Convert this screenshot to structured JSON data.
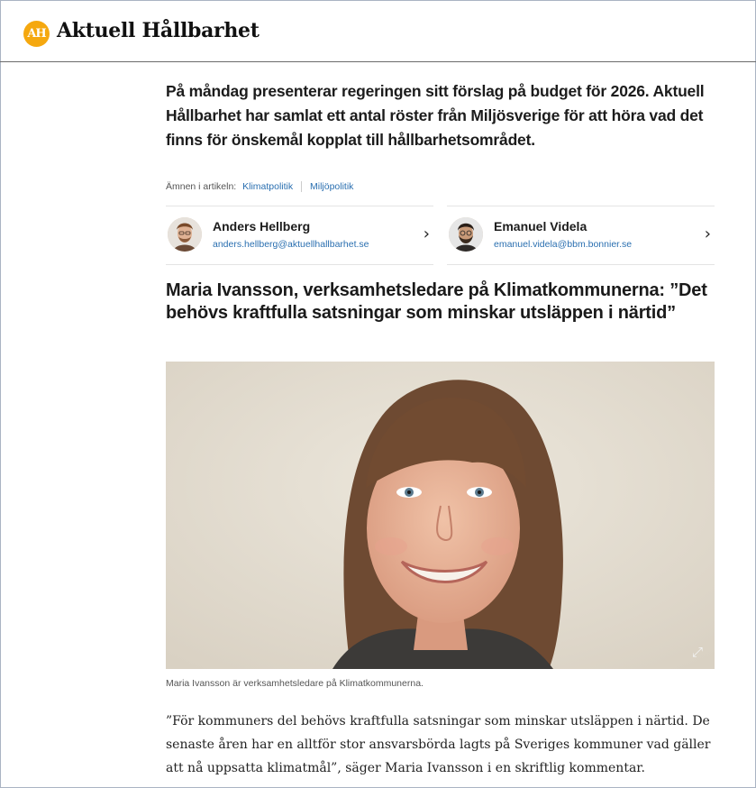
{
  "site": {
    "logo_badge": "AH",
    "name": "Aktuell Hållbarhet"
  },
  "article": {
    "ingress": "På måndag presenterar regeringen sitt förslag på budget för 2026. Aktuell Hållbarhet har samlat ett antal röster från Miljösverige för att höra vad det finns för önskemål kopplat till hållbarhetsområdet.",
    "topics_label": "Ämnen i artikeln:",
    "topics": [
      "Klimatpolitik",
      "Miljöpolitik"
    ],
    "authors": [
      {
        "name": "Anders Hellberg",
        "email": "anders.hellberg@aktuellhallbarhet.se",
        "icon": "chevron-right-icon"
      },
      {
        "name": "Emanuel Videla",
        "email": "emanuel.videla@bbm.bonnier.se",
        "icon": "chevron-right-icon"
      }
    ],
    "headline": "Maria Ivansson, verksamhetsledare på Klimatkommunerna: ”Det behövs kraftfulla satsningar som minskar utsläppen i närtid”",
    "photo_caption": "Maria Ivansson är verksamhetsledare på Klimatkommunerna.",
    "photo_expand_icon": "expand-icon",
    "body": "”För kommuners del behövs kraftfulla satsningar som minskar utsläppen i närtid. De senaste åren har en alltför stor ansvarsbörda lagts på Sveriges kommuner vad gäller att nå uppsatta klimatmål”, säger Maria Ivansson i en skriftlig kommentar."
  },
  "colors": {
    "brand": "#f5a80f",
    "link": "#2a6fb0",
    "text": "#1c1c1c"
  }
}
